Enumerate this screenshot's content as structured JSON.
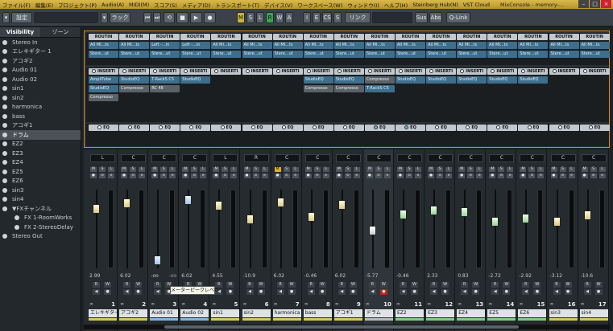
{
  "menu": [
    "ファイル(F)",
    "編集(E)",
    "プロジェクト(P)",
    "Audio(A)",
    "MIDI(M)",
    "スコア(S)",
    "メディア(D)",
    "トランスポート(T)",
    "デバイス(V)",
    "ワークスペース(W)",
    "ウィンドウ(I)",
    "ヘルプ(H)",
    "Steinberg Hub(N)",
    "VST Cloud"
  ],
  "window_title": "MixConsole - memory-...",
  "toolbar": {
    "settings_label": "設定",
    "rack_label": "ラック",
    "mode_buttons": [
      "M",
      "S",
      "L",
      "R",
      "W",
      "A"
    ],
    "i_label": "I",
    "e_label": "E",
    "cs_label": "CS",
    "s_label": "S",
    "link_label": "リンク",
    "sus_label": "Sus",
    "abs_label": "Abs",
    "qlink_label": "Q-Link"
  },
  "left_tabs": [
    "Visibility",
    "ゾーン"
  ],
  "visibility": [
    {
      "name": "Stereo In"
    },
    {
      "name": "エレキギター 1"
    },
    {
      "name": "アコギ2"
    },
    {
      "name": "Audio 01"
    },
    {
      "name": "Audio 02"
    },
    {
      "name": "sin1"
    },
    {
      "name": "sin2"
    },
    {
      "name": "harmonica"
    },
    {
      "name": "bass"
    },
    {
      "name": "アコギ1"
    },
    {
      "name": "ドラム",
      "selected": true
    },
    {
      "name": "EZ2"
    },
    {
      "name": "EZ3"
    },
    {
      "name": "EZ4"
    },
    {
      "name": "EZ5"
    },
    {
      "name": "EZ6"
    },
    {
      "name": "sin3"
    },
    {
      "name": "sin4"
    },
    {
      "name": "FXチャンネル",
      "group": true
    },
    {
      "name": "FX 1-RoomWorks",
      "sub": true
    },
    {
      "name": "FX 2-StereoDelay",
      "sub": true
    },
    {
      "name": "Stereo Out"
    }
  ],
  "rack_labels": {
    "routing": "ROUTIN",
    "inserts": "INSERTI",
    "eq": "EQ"
  },
  "channels": [
    {
      "num": "1",
      "name": "エレキギター",
      "pan": "L",
      "level": "2.99",
      "peak": "",
      "routing": [
        "All MI...ts",
        "Stere...ut"
      ],
      "inserts": [
        "AmpliTube",
        "StudioEQ",
        "Compresso"
      ],
      "color": "#d9c95a"
    },
    {
      "num": "2",
      "name": "アコギ2",
      "pan": "C",
      "level": "6.02",
      "peak": "",
      "routing": [
        "All MI...ts",
        "Stere...ut"
      ],
      "inserts": [
        "StudioEQ",
        "Compresso"
      ],
      "color": "#d9c95a"
    },
    {
      "num": "3",
      "name": "Audio 01",
      "pan": "C",
      "level": "-oo",
      "peak": "-oo",
      "routing": [
        "Left -...in",
        "Stere...ut"
      ],
      "inserts": [
        "T-RackS C5",
        "RC 48"
      ],
      "color": "#7fb7e0"
    },
    {
      "num": "4",
      "name": "Audio 02",
      "pan": "C",
      "level": "6.02",
      "peak": "",
      "routing": [
        "Left -...in",
        "Stere...ut"
      ],
      "inserts": [
        "StudioEQ"
      ],
      "color": "#7fb7e0"
    },
    {
      "num": "5",
      "name": "sin1",
      "pan": "L",
      "level": "4.55",
      "peak": "",
      "routing": [
        "All MI...ts",
        "Stere...ut"
      ],
      "inserts": [],
      "color": "#d9c95a"
    },
    {
      "num": "6",
      "name": "sin2",
      "pan": "R",
      "level": "-10.9",
      "peak": "",
      "routing": [
        "All MI...ts",
        "Stere...ut"
      ],
      "inserts": [],
      "color": "#d9c95a"
    },
    {
      "num": "7",
      "name": "harmonica",
      "pan": "C",
      "level": "6.02",
      "peak": "",
      "routing": [
        "All MI...ts",
        "Stere...ut"
      ],
      "inserts": [],
      "color": "#d9c95a"
    },
    {
      "num": "8",
      "name": "bass",
      "pan": "C",
      "level": "-0.46",
      "peak": "",
      "routing": [
        "All MI...ts",
        "Stere...ut"
      ],
      "inserts": [
        "StudioEQ",
        "Compresso"
      ],
      "color": "#d9c95a"
    },
    {
      "num": "9",
      "name": "アコギ1",
      "pan": "C",
      "level": "6.02",
      "peak": "",
      "routing": [
        "All MI...ts",
        "Stere...ut"
      ],
      "inserts": [
        "StudioEQ",
        "Compresso"
      ],
      "color": "#d9c95a"
    },
    {
      "num": "10",
      "name": "ドラム",
      "pan": "C",
      "level": "-5.77",
      "peak": "",
      "routing": [
        "All MI...ts",
        "Stere...ut"
      ],
      "inserts": [
        "Compresso",
        "T-RackS C5"
      ],
      "color": "#bbbbbb"
    },
    {
      "num": "11",
      "name": "EZ2",
      "pan": "C",
      "level": "-0.46",
      "peak": "",
      "routing": [
        "All MI...ts",
        "Stere...ut"
      ],
      "inserts": [
        "StudioEQ"
      ],
      "color": "#7fd07f"
    },
    {
      "num": "12",
      "name": "EZ3",
      "pan": "C",
      "level": "2.33",
      "peak": "",
      "routing": [
        "All MI...ts",
        "Stere...ut"
      ],
      "inserts": [
        "StudioEQ"
      ],
      "color": "#7fd07f"
    },
    {
      "num": "13",
      "name": "EZ4",
      "pan": "C",
      "level": "0.83",
      "peak": "",
      "routing": [
        "All MI...ts",
        "Stere...ut"
      ],
      "inserts": [
        "StudioEQ"
      ],
      "color": "#7fd07f"
    },
    {
      "num": "14",
      "name": "EZ5",
      "pan": "C",
      "level": "-2.72",
      "peak": "",
      "routing": [
        "All MI...ts",
        "Stere...ut"
      ],
      "inserts": [
        "StudioEQ"
      ],
      "color": "#7fd07f"
    },
    {
      "num": "15",
      "name": "EZ6",
      "pan": "C",
      "level": "-2.92",
      "peak": "",
      "routing": [
        "All MI...ts",
        "Stere...ut"
      ],
      "inserts": [
        "StudioEQ"
      ],
      "color": "#7fd07f"
    },
    {
      "num": "16",
      "name": "sin3",
      "pan": "C",
      "level": "-3.12",
      "peak": "",
      "routing": [
        "All MI...ts",
        "Stere...ut"
      ],
      "inserts": [],
      "color": "#d9c95a"
    },
    {
      "num": "17",
      "name": "sin4",
      "pan": "C",
      "level": "-10.6",
      "peak": "",
      "routing": [
        "All MI...ts",
        "Stere...ut"
      ],
      "inserts": [],
      "color": "#d9c95a"
    }
  ],
  "fader_pos": [
    0.21,
    0.13,
    0.95,
    0.08,
    0.16,
    0.36,
    0.12,
    0.33,
    0.15,
    0.52,
    0.29,
    0.23,
    0.25,
    0.4,
    0.35,
    0.4,
    0.3
  ],
  "tooltip": "メーターピークレベル"
}
